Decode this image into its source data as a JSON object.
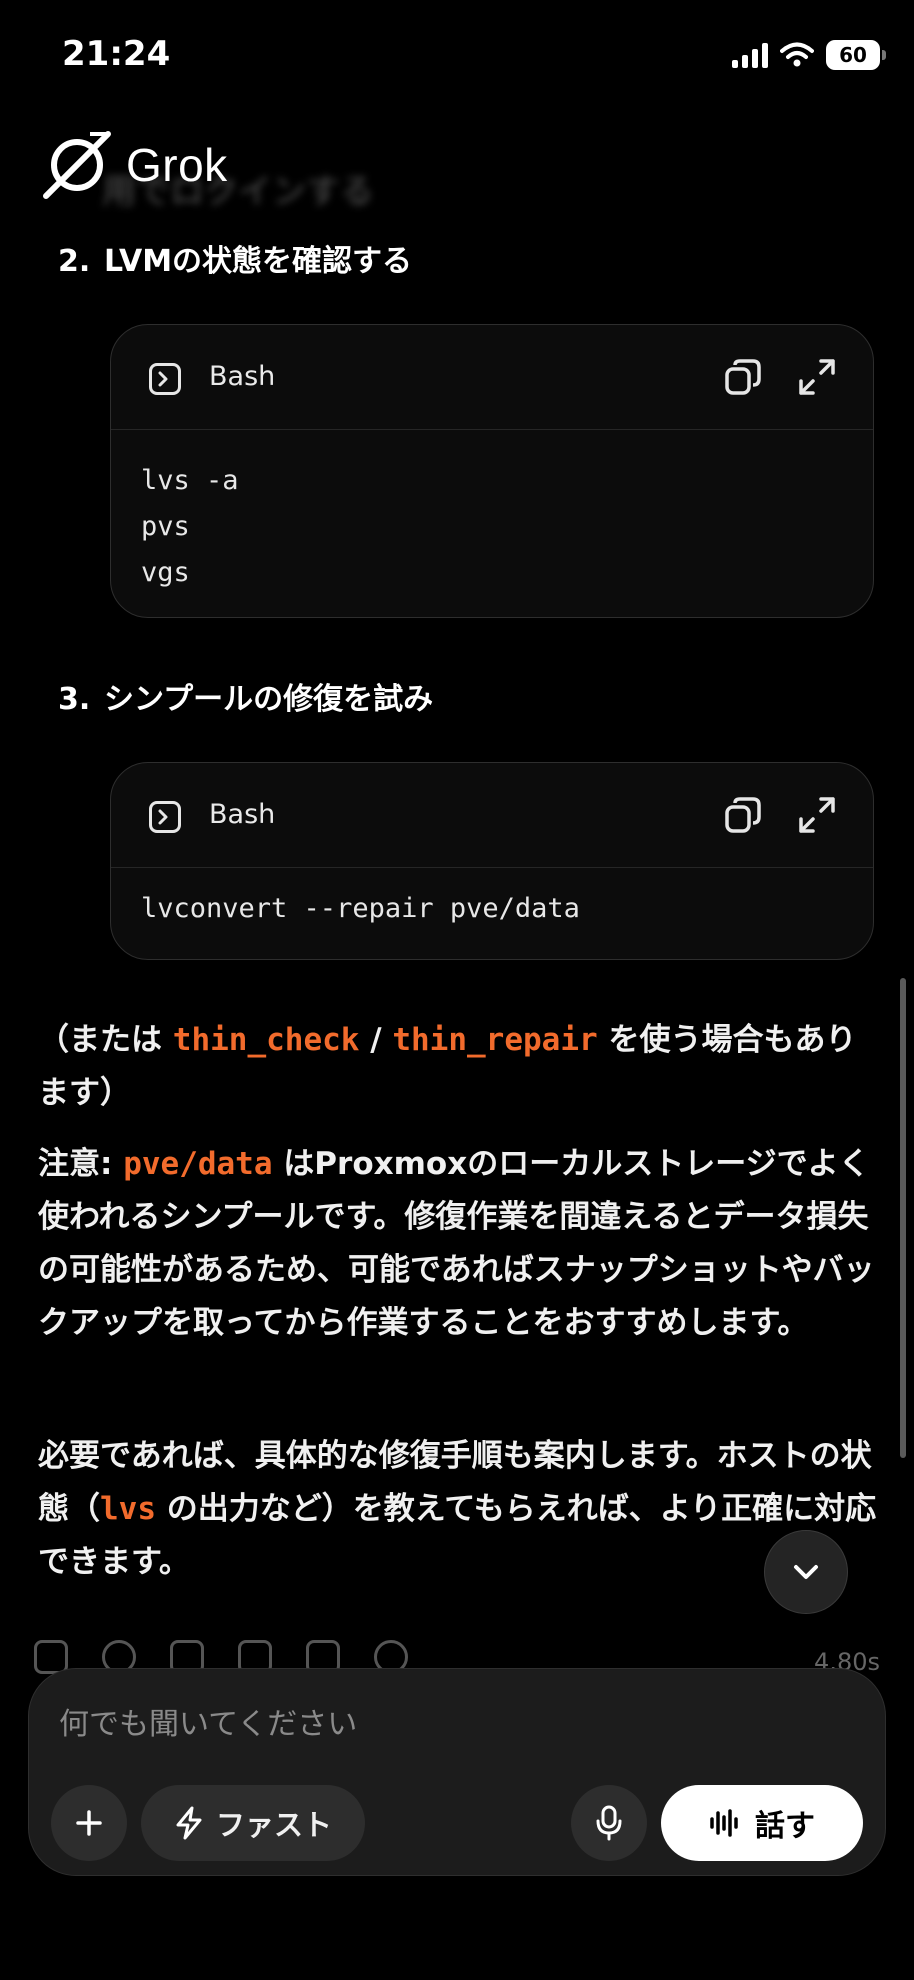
{
  "status_bar": {
    "time": "21:24",
    "battery": "60"
  },
  "brand": {
    "name": "Grok",
    "ghost": "用でロクインする"
  },
  "steps": [
    {
      "number": "2.",
      "title": "LVMの状態を確認する",
      "code_lang": "Bash",
      "code": "lvs -a\npvs\nvgs"
    },
    {
      "number": "3.",
      "title": "シンプールの修復を試み",
      "code_lang": "Bash",
      "code": "lvconvert --repair pve/data"
    }
  ],
  "para1": {
    "prefix": "（または ",
    "code1": "thin_check",
    "sep": " / ",
    "code2": "thin_repair",
    "suffix": " を使う場合もあります）"
  },
  "para2": {
    "label": "注意: ",
    "code": "pve/data",
    "text": " はProxmoxのローカルストレージでよく使われるシンプールです。修復作業を間違えるとデータ損失の可能性があるため、可能であればスナップショットやバックアップを取ってから作業することをおすすめします。"
  },
  "para3": {
    "prefix": "必要であれば、具体的な修復手順も案内します。ホストの状態（",
    "code": "lvs",
    "suffix": " の出力など）を教えてもらえれば、より正確に対応できます。"
  },
  "response_meta": {
    "elapsed": "4.80s"
  },
  "composer": {
    "placeholder": "何でも聞いてください",
    "mode_label": "ファスト",
    "talk_label": "話す"
  },
  "icons": [
    "terminal-icon",
    "copy-icon",
    "expand-icon",
    "chevron-down-icon",
    "plus-icon",
    "lightning-icon",
    "mic-icon",
    "waveform-icon",
    "grok-logo-icon"
  ]
}
